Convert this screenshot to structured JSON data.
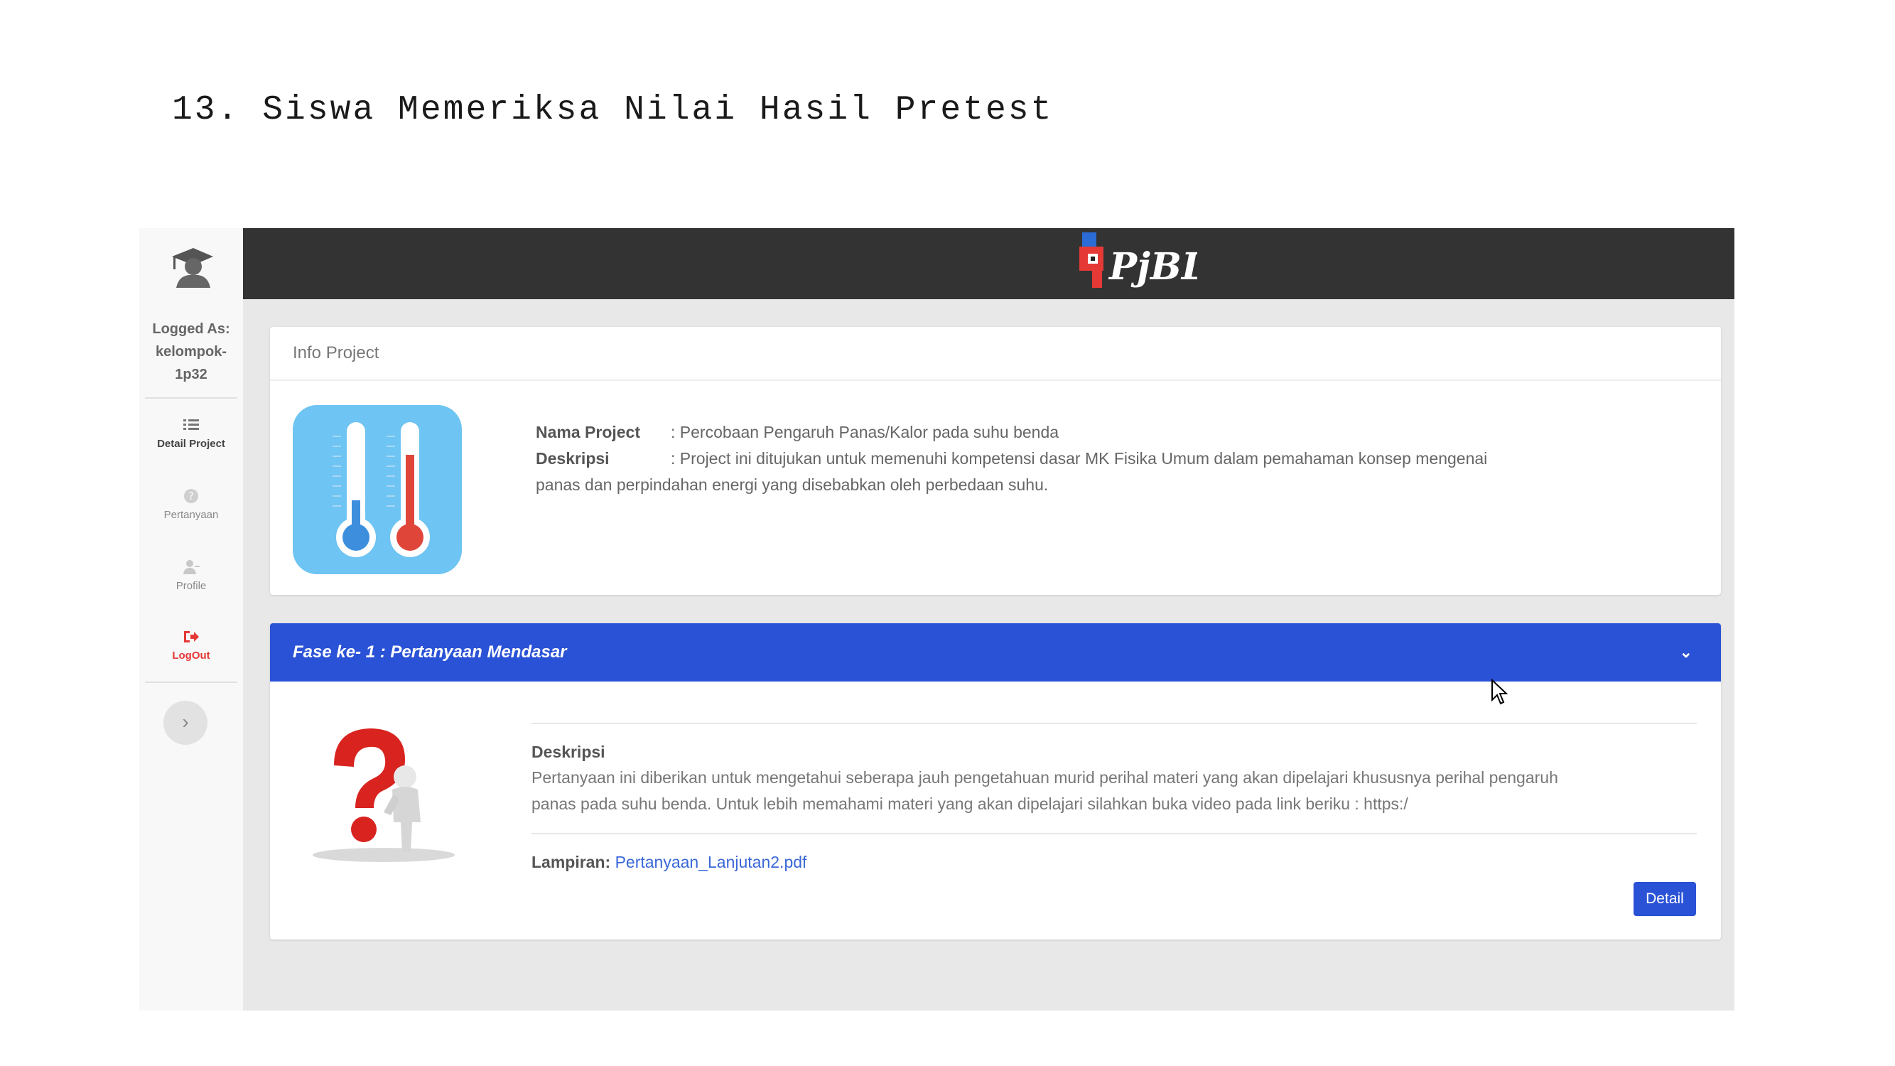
{
  "document": {
    "heading": "13. Siswa Memeriksa Nilai Hasil Pretest"
  },
  "sidebar": {
    "logged_as_label": "Logged As:",
    "username_line1": "kelompok-",
    "username_line2": "1p32",
    "items": [
      {
        "label": "Detail Project",
        "icon": "list-icon"
      },
      {
        "label": "Pertanyaan",
        "icon": "question-icon"
      },
      {
        "label": "Profile",
        "icon": "user-icon"
      },
      {
        "label": "LogOut",
        "icon": "logout-icon"
      }
    ],
    "expand_glyph": "›"
  },
  "topbar": {
    "logo_text": "PjBL"
  },
  "info_project": {
    "header": "Info Project",
    "name_label": "Nama Project",
    "name_value": ": Percobaan Pengaruh Panas/Kalor pada suhu benda",
    "desc_label": "Deskripsi",
    "desc_value_line1": ": Project ini ditujukan untuk memenuhi kompetensi dasar MK Fisika Umum dalam pemahaman konsep mengenai",
    "desc_value_line2": "panas dan perpindahan energi yang disebabkan oleh perbedaan suhu."
  },
  "phase": {
    "header": "Fase ke- 1 : Pertanyaan Mendasar",
    "chevron": "⌄",
    "desc_label": "Deskripsi",
    "desc_line1": "Pertanyaan ini diberikan untuk mengetahui seberapa jauh pengetahuan murid perihal materi yang akan dipelajari khususnya perihal pengaruh",
    "desc_line2": "panas pada suhu benda. Untuk lebih memahami materi yang akan dipelajari silahkan buka video pada link beriku : https:/",
    "attachment_label": "Lampiran:",
    "attachment_link": "Pertanyaan_Lanjutan2.pdf",
    "detail_button": "Detail"
  },
  "colors": {
    "topbar": "#333333",
    "phase_header": "#2a52d6",
    "logout": "#e53935",
    "link": "#3a68d8"
  }
}
